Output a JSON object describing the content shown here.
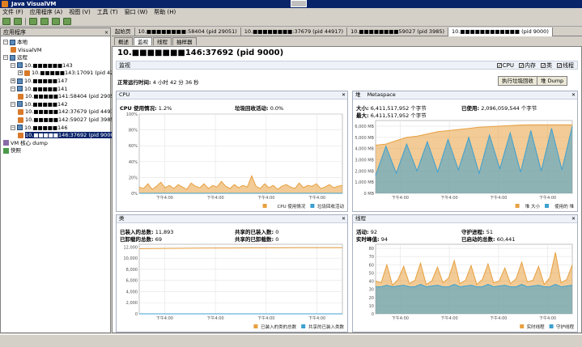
{
  "window": {
    "title": "Java VisualVM"
  },
  "menu": [
    "文件 (F)",
    "应用程序 (A)",
    "视图 (V)",
    "工具 (T)",
    "窗口 (W)",
    "帮助 (H)"
  ],
  "left_panel": {
    "title": "应用程序",
    "close": "×",
    "tree": [
      {
        "indent": 0,
        "toggle": "−",
        "icon": "host",
        "label": "本地"
      },
      {
        "indent": 1,
        "toggle": "",
        "icon": "java",
        "label": "VisualVM"
      },
      {
        "indent": 0,
        "toggle": "−",
        "icon": "host",
        "label": "远程"
      },
      {
        "indent": 1,
        "toggle": "−",
        "icon": "host",
        "label": "10.■■■■■■143"
      },
      {
        "indent": 2,
        "toggle": "+",
        "icon": "java",
        "label": "10.■■■■■143:17091 (pid 42598)"
      },
      {
        "indent": 1,
        "toggle": "+",
        "icon": "host",
        "label": "10.■■■■■147"
      },
      {
        "indent": 1,
        "toggle": "−",
        "icon": "host",
        "label": "10.■■■■■141"
      },
      {
        "indent": 2,
        "toggle": "",
        "icon": "java",
        "label": "10.■■■■■141:58404 (pid 29051)"
      },
      {
        "indent": 1,
        "toggle": "−",
        "icon": "host",
        "label": "10.■■■■■142"
      },
      {
        "indent": 2,
        "toggle": "",
        "icon": "java",
        "label": "10.■■■■■142:37679 (pid 44917)"
      },
      {
        "indent": 2,
        "toggle": "",
        "icon": "java",
        "label": "10.■■■■■142:59027 (pid 3985)"
      },
      {
        "indent": 1,
        "toggle": "−",
        "icon": "host",
        "label": "10.■■■■■146"
      },
      {
        "indent": 2,
        "toggle": "",
        "icon": "java",
        "label": "10.■■■■■146:37692 (pid 9000)",
        "selected": true
      },
      {
        "indent": 0,
        "toggle": "",
        "icon": "core",
        "label": "VM 核心 dump"
      },
      {
        "indent": 0,
        "toggle": "",
        "icon": "snap",
        "label": "快照"
      }
    ]
  },
  "doc_tabs": [
    {
      "label": "起始页"
    },
    {
      "label": "10.■■■■■■■■:58404 (pid 29051)"
    },
    {
      "label": "10.■■■■■■■■:37679 (pid 44917)"
    },
    {
      "label": "10.■■■■■■■■59027 (pid 3985)"
    },
    {
      "label": "10.■■■■■■■■■■■■ (pid 9000)",
      "active": true
    }
  ],
  "sub_tabs": [
    {
      "label": "概述"
    },
    {
      "label": "监视",
      "active": true
    },
    {
      "label": "线程"
    },
    {
      "label": "抽样器"
    }
  ],
  "header": {
    "process_title": "10.■■■■■■■146:37692  (pid 9000)",
    "section": "监视",
    "checks": [
      "CPU",
      "内存",
      "类",
      "线程"
    ],
    "uptime_label": "正常运行时间:",
    "uptime_value": "4 小时 42 分 36 秒",
    "gc_button": "执行垃圾回收",
    "dump_button": "堆 Dump"
  },
  "cpu_panel": {
    "title": "CPU",
    "usage_label": "CPU 使用情况:",
    "usage_value": "1.2%",
    "gc_label": "垃圾回收活动:",
    "gc_value": "0.0%",
    "legend": [
      "CPU 使用情况",
      "垃圾回收活动"
    ]
  },
  "heap_panel": {
    "tabs": [
      "堆",
      "Metaspace"
    ],
    "size_label": "大小:",
    "size_value": "6,411,517,952 个字节",
    "max_label": "最大:",
    "max_value": "6,411,517,952 个字节",
    "used_label": "已使用:",
    "used_value": "2,096,059,544 个字节",
    "legend": [
      "堆 大小",
      "使用的 堆"
    ]
  },
  "class_panel": {
    "title": "类",
    "loaded_label": "已装入的总数:",
    "loaded_value": "11,893",
    "unloaded_label": "已卸载的总数:",
    "unloaded_value": "69",
    "shared_loaded_label": "共享的已装入数:",
    "shared_loaded_value": "0",
    "shared_unloaded_label": "共享的已卸载数:",
    "shared_unloaded_value": "0",
    "legend": [
      "已装入的类的总数",
      "共享的已装入类数"
    ]
  },
  "thread_panel": {
    "title": "线程",
    "live_label": "活动:",
    "live_value": "92",
    "peak_label": "实时峰值:",
    "peak_value": "94",
    "daemon_label": "守护进程:",
    "daemon_value": "51",
    "started_label": "已启动的总数:",
    "started_value": "60,441",
    "legend": [
      "实时线程",
      "守护线程"
    ]
  },
  "colors": {
    "cpu": "#e8a040",
    "gc": "#3ca0d0",
    "heap_size": "#e8a040",
    "heap_used": "#3ca0d0",
    "title_bar": "#0a246a"
  },
  "chart_data": [
    {
      "type": "area",
      "title": "CPU",
      "ylabel": "",
      "yticks": [
        "0%",
        "20%",
        "40%",
        "60%",
        "80%",
        "100%"
      ],
      "ylim": [
        0,
        100
      ],
      "xticks": [
        "下午4:00",
        "下午4:00",
        "下午4:00",
        "下午4:00"
      ],
      "series": [
        {
          "name": "CPU 使用情况",
          "values": [
            8,
            6,
            12,
            5,
            9,
            14,
            7,
            10,
            6,
            11,
            8,
            5,
            13,
            9,
            7,
            12,
            6,
            10,
            8,
            15,
            9,
            6,
            11,
            7,
            10,
            8,
            22,
            9,
            6,
            12,
            7,
            10,
            5,
            9,
            11,
            8,
            6,
            13,
            7,
            10,
            9,
            12,
            6,
            8,
            11,
            7,
            9,
            10
          ]
        },
        {
          "name": "垃圾回收活动",
          "values": [
            0,
            0,
            0,
            0,
            0,
            0,
            0,
            0,
            0,
            0,
            0,
            0,
            0,
            0,
            0,
            0,
            0,
            0,
            0,
            0,
            0,
            0,
            0,
            0,
            0,
            0,
            0,
            0,
            0,
            0,
            0,
            0,
            0,
            0,
            0,
            0,
            0,
            0,
            0,
            0,
            0,
            0,
            0,
            0,
            0,
            0,
            0,
            0
          ]
        }
      ]
    },
    {
      "type": "area",
      "title": "堆",
      "ylabel": "",
      "yticks": [
        "0 MB",
        "1,000 MB",
        "2,000 MB",
        "3,000 MB",
        "4,000 MB",
        "5,000 MB",
        "6,000 MB"
      ],
      "ylim": [
        0,
        6500
      ],
      "xticks": [
        "下午4:00",
        "下午4:00",
        "下午4:00",
        "下午4:00"
      ],
      "series": [
        {
          "name": "堆 大小",
          "values": [
            4300,
            4400,
            4700,
            5000,
            5100,
            5300,
            5500,
            5600,
            5700,
            5800,
            5900,
            5950,
            6000,
            6050,
            6100,
            6114,
            6114,
            6114,
            6114,
            6114
          ]
        },
        {
          "name": "使用的 堆",
          "values": [
            1600,
            4200,
            1800,
            4400,
            2000,
            4600,
            1900,
            4800,
            2100,
            5000,
            1800,
            5200,
            2200,
            5400,
            1900,
            5600,
            2000,
            5800,
            2100,
            6000
          ]
        }
      ]
    },
    {
      "type": "line",
      "title": "类",
      "ylabel": "",
      "yticks": [
        "0",
        "2,000",
        "4,000",
        "6,000",
        "8,000",
        "10,000",
        "12,000"
      ],
      "ylim": [
        0,
        12500
      ],
      "xticks": [
        "下午4:00",
        "下午4:00",
        "下午4:00",
        "下午4:00"
      ],
      "series": [
        {
          "name": "已装入的类的总数",
          "values": [
            11700,
            11750,
            11780,
            11800,
            11820,
            11840,
            11860,
            11870,
            11880,
            11893
          ]
        },
        {
          "name": "共享的已装入类数",
          "values": [
            0,
            0,
            0,
            0,
            0,
            0,
            0,
            0,
            0,
            0
          ]
        }
      ]
    },
    {
      "type": "area",
      "title": "线程",
      "ylabel": "",
      "yticks": [
        "0",
        "10",
        "20",
        "30",
        "40",
        "50",
        "60",
        "70",
        "80"
      ],
      "ylim": [
        0,
        85
      ],
      "xticks": [
        "下午4:00",
        "下午4:00",
        "下午4:00",
        "下午4:00"
      ],
      "series": [
        {
          "name": "实时线程",
          "values": [
            40,
            38,
            60,
            35,
            42,
            58,
            37,
            41,
            62,
            36,
            40,
            57,
            38,
            44,
            65,
            37,
            41,
            59,
            36,
            42,
            61,
            38,
            40,
            56,
            37,
            43,
            63,
            39,
            41,
            58,
            36,
            44,
            75,
            38,
            42,
            60
          ]
        },
        {
          "name": "守护线程",
          "values": [
            33,
            33,
            35,
            33,
            34,
            35,
            33,
            33,
            36,
            33,
            34,
            35,
            33,
            33,
            36,
            33,
            34,
            35,
            33,
            33,
            36,
            33,
            34,
            35,
            33,
            33,
            36,
            33,
            34,
            35,
            33,
            33,
            36,
            33,
            34,
            35
          ]
        }
      ]
    }
  ]
}
